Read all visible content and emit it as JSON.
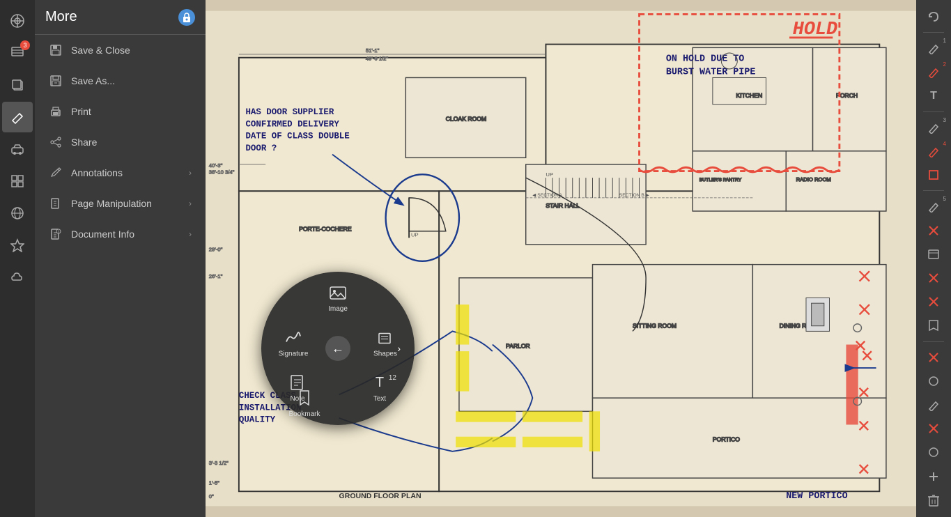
{
  "app": {
    "title": "More"
  },
  "sidebar": {
    "title": "More",
    "lock_icon": "🔒",
    "menu_items": [
      {
        "id": "save-close",
        "label": "Save & Close",
        "icon": "save"
      },
      {
        "id": "save-as",
        "label": "Save As...",
        "icon": "save-as"
      },
      {
        "id": "print",
        "label": "Print",
        "icon": "print"
      },
      {
        "id": "share",
        "label": "Share",
        "icon": "share"
      },
      {
        "id": "annotations",
        "label": "Annotations",
        "icon": "pen",
        "has_arrow": true
      },
      {
        "id": "page-manipulation",
        "label": "Page Manipulation",
        "icon": "page",
        "has_arrow": true
      },
      {
        "id": "document-info",
        "label": "Document Info",
        "icon": "info",
        "has_arrow": true
      }
    ]
  },
  "left_icons": [
    {
      "id": "home",
      "icon": "⊙",
      "badge": null
    },
    {
      "id": "layers",
      "icon": "📋",
      "badge": "3"
    },
    {
      "id": "copy",
      "icon": "⧉",
      "badge": null
    },
    {
      "id": "edit",
      "icon": "✏",
      "badge": null,
      "active": true
    },
    {
      "id": "vehicle",
      "icon": "🚗",
      "badge": null
    },
    {
      "id": "grid",
      "icon": "⊞",
      "badge": null
    },
    {
      "id": "globe",
      "icon": "🌐",
      "badge": null
    },
    {
      "id": "star",
      "icon": "⭐",
      "badge": null
    },
    {
      "id": "cloud",
      "icon": "☁",
      "badge": null
    }
  ],
  "right_toolbar": [
    {
      "id": "undo",
      "icon": "↩",
      "color": "normal"
    },
    {
      "id": "pen1",
      "icon": "✏",
      "color": "normal",
      "badge": "1"
    },
    {
      "id": "pen2",
      "icon": "✏",
      "color": "red",
      "badge": "2"
    },
    {
      "id": "text",
      "icon": "T",
      "color": "normal"
    },
    {
      "id": "pen3",
      "icon": "✏",
      "color": "normal",
      "badge": "3"
    },
    {
      "id": "pen4",
      "icon": "✏",
      "color": "red",
      "badge": "4"
    },
    {
      "id": "rect",
      "icon": "□",
      "color": "red"
    },
    {
      "id": "pen5",
      "icon": "✏",
      "color": "normal",
      "badge": "5"
    },
    {
      "id": "cross1",
      "icon": "✕",
      "color": "red"
    },
    {
      "id": "image-tool",
      "icon": "⬚",
      "color": "normal"
    },
    {
      "id": "cross2",
      "icon": "✕",
      "color": "red"
    },
    {
      "id": "cross3",
      "icon": "✕",
      "color": "red"
    },
    {
      "id": "bookmark",
      "icon": "🔖",
      "color": "normal"
    },
    {
      "id": "cross4",
      "icon": "✕",
      "color": "red"
    },
    {
      "id": "circle1",
      "icon": "○",
      "color": "normal"
    },
    {
      "id": "pen6",
      "icon": "✏",
      "color": "normal"
    },
    {
      "id": "cross5",
      "icon": "✕",
      "color": "red"
    },
    {
      "id": "circle2",
      "icon": "○",
      "color": "normal"
    },
    {
      "id": "add",
      "icon": "+",
      "color": "normal"
    },
    {
      "id": "trash",
      "icon": "🗑",
      "color": "normal"
    }
  ],
  "radial_menu": {
    "items": [
      {
        "id": "image",
        "label": "Image",
        "position": "top",
        "icon": "🖼"
      },
      {
        "id": "signature",
        "label": "Signature",
        "position": "left-mid",
        "icon": "✍"
      },
      {
        "id": "shapes",
        "label": "Shapes",
        "position": "right-mid",
        "icon": "⬚"
      },
      {
        "id": "note",
        "label": "Note",
        "position": "bottom-left",
        "icon": "📝"
      },
      {
        "id": "bookmark",
        "label": "Bookmark",
        "position": "bottom-center",
        "icon": "🔖"
      },
      {
        "id": "text",
        "label": "Text",
        "position": "bottom-right",
        "icon": "T"
      }
    ],
    "center_icon": "←"
  },
  "annotations": {
    "hold_text": "HOLD",
    "hold_note": "ON HOLD DUE TO\nBURST WATER PIPE",
    "question_text": "HAS DOOR SUPPLIER\nCONFIRMED DELIVERY\nDATE OF GLASS DOUBLE\nDOOR ?",
    "check_text": "CHECK GLASS\nINSTALLATION\nQUALITY",
    "new_portico": "NEW PORTICO"
  }
}
